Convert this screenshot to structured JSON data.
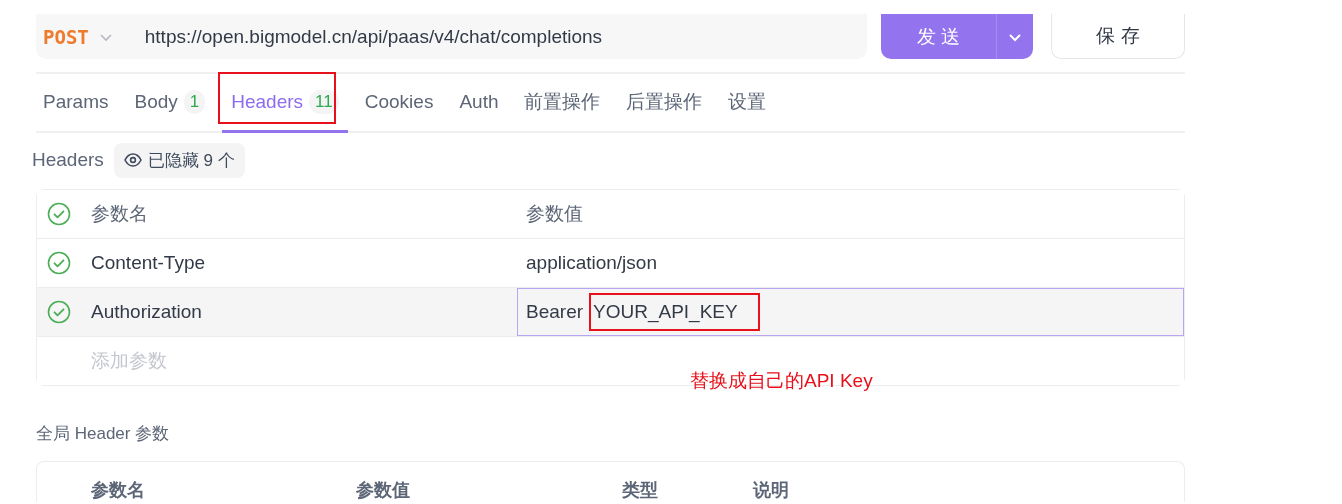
{
  "request": {
    "method": "POST",
    "url": "https://open.bigmodel.cn/api/paas/v4/chat/completions",
    "send_label": "发 送",
    "save_label": "保 存"
  },
  "tabs": [
    {
      "label": "Params",
      "selected": false,
      "marked": false
    },
    {
      "label": "Body",
      "badge": "1",
      "selected": false,
      "marked": false
    },
    {
      "label": "Headers",
      "badge": "11",
      "selected": true,
      "marked": true
    },
    {
      "label": "Cookies",
      "selected": false,
      "marked": false
    },
    {
      "label": "Auth",
      "selected": false,
      "marked": false
    },
    {
      "label": "前置操作",
      "selected": false,
      "marked": false
    },
    {
      "label": "后置操作",
      "selected": false,
      "marked": false
    },
    {
      "label": "设置",
      "selected": false,
      "marked": false
    }
  ],
  "headers_section": {
    "title": "Headers",
    "hidden_badge": "已隐藏 9 个",
    "all_enabled": true,
    "columns": [
      "参数名",
      "参数值"
    ],
    "rows": [
      {
        "name": "Content-Type",
        "value": "application/json",
        "enabled": true,
        "selected": false
      },
      {
        "name": "Authorization",
        "value": "Bearer",
        "value_key": "YOUR_API_KEY",
        "enabled": true,
        "selected": true,
        "key_marked": true
      }
    ],
    "add_placeholder": "添加参数"
  },
  "annotation_note": "替换成自己的API Key",
  "global_headers": {
    "title": "全局 Header 参数",
    "columns": [
      "参数名",
      "参数值",
      "类型",
      "说明"
    ]
  }
}
